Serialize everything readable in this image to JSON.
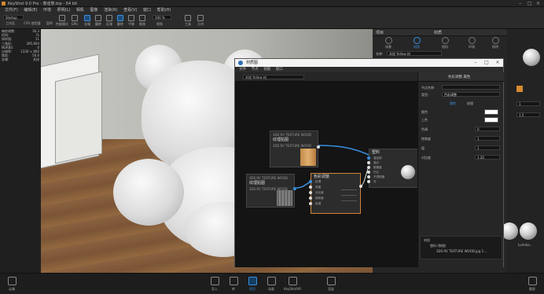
{
  "app": {
    "title": "KeyShot 9.0 Pro - 泰迪熊.bip - 64 bit",
    "menus": [
      "文件(F)",
      "编辑(E)",
      "环境",
      "照明(L)",
      "相机",
      "图像",
      "渲染(R)",
      "查看(V)",
      "窗口",
      "帮助(H)"
    ]
  },
  "toolbar": {
    "workspace_label": "Startup",
    "cpu_label": "CPU 使用量",
    "pause_label": "暂停",
    "fps_label": "性能模式",
    "zoom_value": "100 %",
    "buttons": [
      {
        "label": "工作区",
        "icon": "workspace-icon"
      },
      {
        "label": "CPU 使用量",
        "icon": "cpu-icon"
      },
      {
        "label": "暂停",
        "icon": "pause-icon"
      },
      {
        "label": "性能模式",
        "icon": "performance-icon"
      },
      {
        "label": "GPU",
        "icon": "gpu-icon"
      },
      {
        "label": "去噪",
        "icon": "denoise-icon"
      },
      {
        "label": "翻转",
        "icon": "flip-icon"
      },
      {
        "label": "区域",
        "icon": "region-icon"
      },
      {
        "label": "翻转",
        "icon": "tumble-icon"
      },
      {
        "label": "平移",
        "icon": "pan-icon"
      },
      {
        "label": "推移",
        "icon": "dolly-icon"
      },
      {
        "label": "视角",
        "icon": "perspective-icon"
      },
      {
        "label": "工具",
        "icon": "tools-icon"
      },
      {
        "label": "几何",
        "icon": "geometry-icon"
      }
    ]
  },
  "stats": [
    {
      "k": "每秒帧数:",
      "v": "30.3"
    },
    {
      "k": "时间:",
      "v": "7s"
    },
    {
      "k": "采样值:",
      "v": "11"
    },
    {
      "k": "三角形:",
      "v": "395,904"
    },
    {
      "k": "NURBS:",
      "v": "0"
    },
    {
      "k": "分辨率:",
      "v": "1330 × 800"
    },
    {
      "k": "焦距:",
      "v": "50.0"
    },
    {
      "k": "去噪:",
      "v": "关闭"
    }
  ],
  "right_panel": {
    "header": "项目",
    "header_right": "材质",
    "tabs": [
      "场景",
      "材质",
      "相机",
      "环境",
      "照明",
      "图像"
    ],
    "name_label": "名称:",
    "name_value": "木纹 Yellow 材"
  },
  "graph_window": {
    "title": "材质图",
    "menus": [
      "文件",
      "节点",
      "视图",
      "窗口"
    ],
    "field_value": "木纹 Yellow 材",
    "nodes": {
      "tex_top": {
        "type": "3DS RV TEXTURE WOOD",
        "name": "纹理贴图",
        "sub": "3DS RV TEXTURE WOOD"
      },
      "tex_bot": {
        "type": "3DS RV TEXTURE WOOD",
        "name": "纹理贴图",
        "sub": "3DS RV TEXTURE WOOD"
      },
      "material": {
        "name": "塑料",
        "ports": [
          "漫反射",
          "高光",
          "粗糙度",
          "凹凸",
          "不透明度",
          "光"
        ]
      },
      "color_adjust": {
        "name": "色彩调整",
        "ports": [
          "纹理",
          "亮度",
          "对比度",
          "饱和度",
          "色调"
        ]
      }
    },
    "props": {
      "tab": "色彩调整 属性",
      "node_name_label": "节点名称:",
      "type_label": "类型:",
      "type_value": "色彩调整",
      "subtabs": [
        "属性",
        "纹理"
      ],
      "rows": [
        {
          "k": "颜色",
          "v": ""
        },
        {
          "k": "上色",
          "v": ""
        },
        {
          "k": "色调",
          "v": "0"
        },
        {
          "k": "饱和度",
          "v": "1"
        },
        {
          "k": "值",
          "v": "1"
        },
        {
          "k": "对比度",
          "v": "1.20"
        }
      ],
      "tree": [
        "材质",
        "塑料 (物理)",
        "3DS RV TEXTURE WOOD.jpg 1..."
      ]
    }
  },
  "far_right": {
    "values": [
      "1",
      "1.5"
    ],
    "thumb_labels": [
      "",
      "Lumine..."
    ]
  },
  "statusbar": {
    "left_label": "云端",
    "buttons": [
      {
        "label": "导入",
        "icon": "import-icon"
      },
      {
        "label": "库",
        "icon": "library-icon"
      },
      {
        "label": "项目",
        "icon": "project-icon"
      },
      {
        "label": "动画",
        "icon": "animation-icon"
      },
      {
        "label": "KeyShotVR",
        "icon": "keyshotvr-icon"
      },
      {
        "label": "渲染",
        "icon": "render-icon"
      }
    ],
    "right_label": "截屏"
  }
}
